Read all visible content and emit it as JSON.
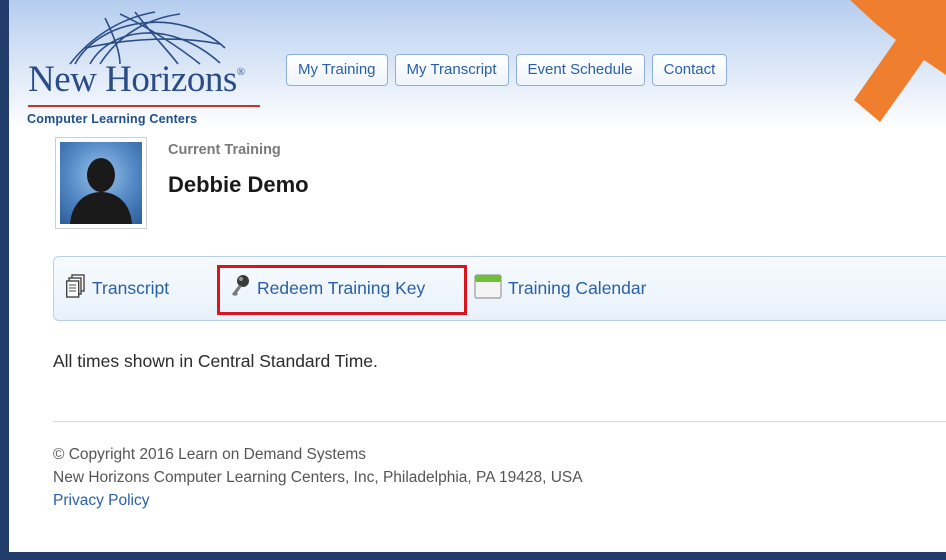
{
  "logo": {
    "name": "New Horizons",
    "registered_mark": "®",
    "subtitle": "Computer Learning Centers"
  },
  "nav": {
    "items": [
      {
        "label": "My Training"
      },
      {
        "label": "My Transcript"
      },
      {
        "label": "Event Schedule"
      },
      {
        "label": "Contact"
      }
    ]
  },
  "profile": {
    "section_label": "Current Training",
    "name": "Debbie Demo"
  },
  "toolbar": {
    "items": [
      {
        "label": "Transcript",
        "icon": "document-stack-icon"
      },
      {
        "label": "Redeem Training Key",
        "icon": "key-icon"
      },
      {
        "label": "Training Calendar",
        "icon": "calendar-icon"
      }
    ]
  },
  "timezone_note": "All times shown in Central Standard Time.",
  "footer": {
    "copyright": "© Copyright 2016 Learn on Demand Systems",
    "address": "New Horizons Computer Learning Centers, Inc, Philadelphia, PA 19428, USA",
    "privacy_link": "Privacy Policy"
  },
  "colors": {
    "frame": "#223c6b",
    "link": "#2a5fa8",
    "highlight": "#d9141c",
    "arrow": "#ef7f2f"
  }
}
